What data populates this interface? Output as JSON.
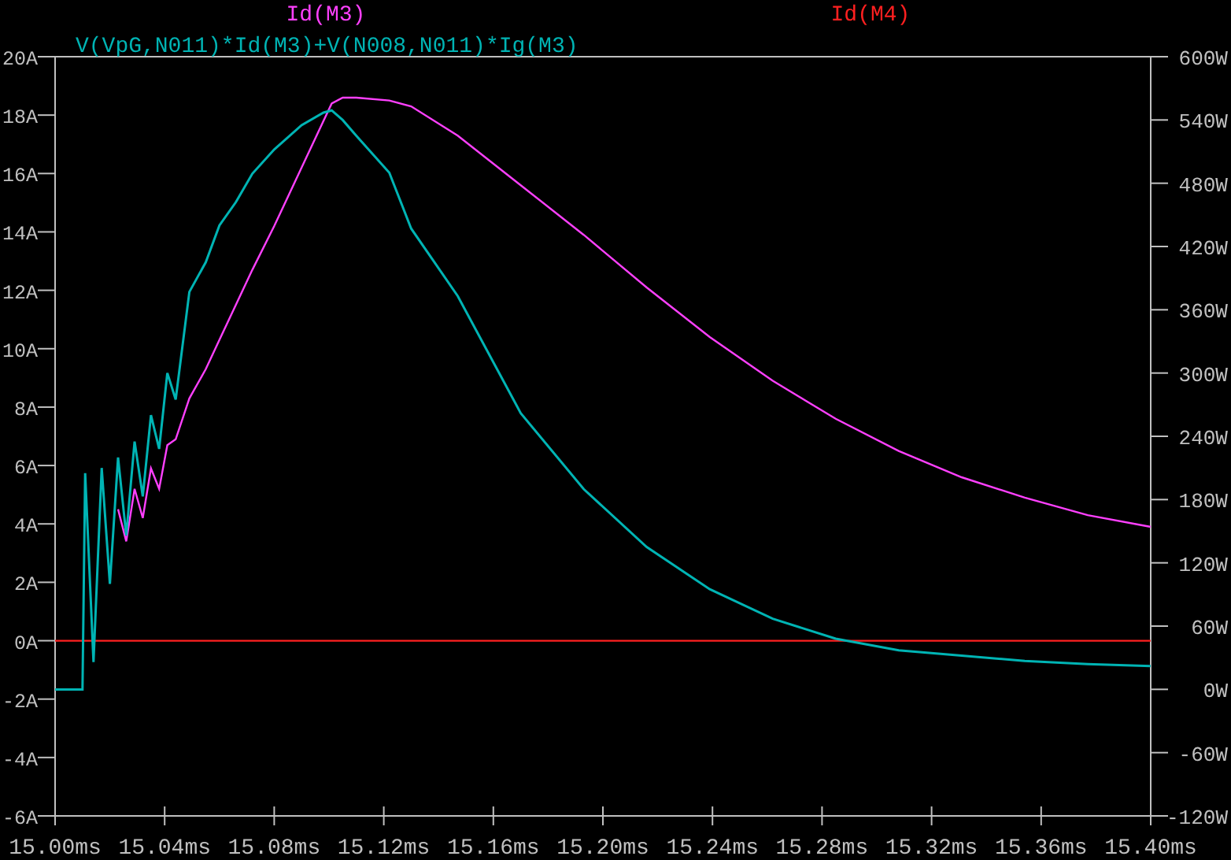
{
  "plot": {
    "chart_data": {
      "type": "line",
      "x": [
        15.0,
        15.01,
        15.011,
        15.014,
        15.017,
        15.02,
        15.023,
        15.026,
        15.029,
        15.032,
        15.035,
        15.038,
        15.041,
        15.044,
        15.049,
        15.055,
        15.06,
        15.066,
        15.072,
        15.08,
        15.09,
        15.098,
        15.101,
        15.105,
        15.11,
        15.122,
        15.13,
        15.147,
        15.17,
        15.193,
        15.216,
        15.239,
        15.262,
        15.285,
        15.308,
        15.331,
        15.354,
        15.377,
        15.4
      ],
      "xlim": [
        15.0,
        15.4
      ],
      "xticks": [
        {
          "value": 15.0,
          "label": "15.00ms"
        },
        {
          "value": 15.04,
          "label": "15.04ms"
        },
        {
          "value": 15.08,
          "label": "15.08ms"
        },
        {
          "value": 15.12,
          "label": "15.12ms"
        },
        {
          "value": 15.16,
          "label": "15.16ms"
        },
        {
          "value": 15.2,
          "label": "15.20ms"
        },
        {
          "value": 15.24,
          "label": "15.24ms"
        },
        {
          "value": 15.28,
          "label": "15.28ms"
        },
        {
          "value": 15.32,
          "label": "15.32ms"
        },
        {
          "value": 15.36,
          "label": "15.36ms"
        },
        {
          "value": 15.4,
          "label": "15.40ms"
        }
      ],
      "ylim": [
        -6,
        20
      ],
      "yticks": [
        {
          "value": 20,
          "label": "20A"
        },
        {
          "value": 18,
          "label": "18A"
        },
        {
          "value": 16,
          "label": "16A"
        },
        {
          "value": 14,
          "label": "14A"
        },
        {
          "value": 12,
          "label": "12A"
        },
        {
          "value": 10,
          "label": "10A"
        },
        {
          "value": 8,
          "label": "8A"
        },
        {
          "value": 6,
          "label": "6A"
        },
        {
          "value": 4,
          "label": "4A"
        },
        {
          "value": 2,
          "label": "2A"
        },
        {
          "value": 0,
          "label": "0A"
        },
        {
          "value": -2,
          "label": "-2A"
        },
        {
          "value": -4,
          "label": "-4A"
        },
        {
          "value": -6,
          "label": "-6A"
        }
      ],
      "y2lim": [
        -120,
        600
      ],
      "y2ticks": [
        {
          "value": 600,
          "label": "600W"
        },
        {
          "value": 540,
          "label": "540W"
        },
        {
          "value": 480,
          "label": "480W"
        },
        {
          "value": 420,
          "label": "420W"
        },
        {
          "value": 360,
          "label": "360W"
        },
        {
          "value": 300,
          "label": "300W"
        },
        {
          "value": 240,
          "label": "240W"
        },
        {
          "value": 180,
          "label": "180W"
        },
        {
          "value": 120,
          "label": "120W"
        },
        {
          "value": 60,
          "label": "60W"
        },
        {
          "value": 0,
          "label": "0W"
        },
        {
          "value": -60,
          "label": "-60W"
        },
        {
          "value": -120,
          "label": "-120W"
        }
      ],
      "series": [
        {
          "name": "Id(M3)",
          "color": "#ff40ff",
          "values": [
            null,
            null,
            null,
            null,
            null,
            null,
            4.5,
            3.4,
            5.2,
            4.2,
            5.9,
            5.2,
            6.7,
            6.9,
            8.3,
            9.3,
            10.3,
            11.5,
            12.7,
            14.2,
            16.2,
            17.8,
            18.4,
            18.6,
            18.6,
            18.5,
            18.3,
            17.3,
            15.6,
            13.9,
            12.1,
            10.4,
            8.9,
            7.6,
            6.5,
            5.6,
            4.9,
            4.3,
            3.9
          ]
        },
        {
          "name": "Id(M4)",
          "color": "#ff2020",
          "values": [
            0,
            0,
            0,
            0,
            0,
            0,
            0,
            0,
            0,
            0,
            0,
            0,
            0,
            0,
            0,
            0,
            0,
            0,
            0,
            0,
            0,
            0,
            0,
            0,
            0,
            0,
            0,
            0,
            0,
            0,
            0,
            0,
            0,
            0,
            0,
            0,
            0,
            0,
            0
          ]
        },
        {
          "name": "V(VpG,N011)*Id(M3)+V(N008,N011)*Ig(M3)",
          "color": "#00b4b4",
          "axis": "y2",
          "values": [
            0,
            0,
            205,
            26,
            210,
            100,
            220,
            146,
            235,
            183,
            260,
            228,
            300,
            275,
            377,
            405,
            440,
            462,
            489,
            512,
            535,
            547,
            549,
            540,
            525,
            490,
            437,
            373,
            262,
            190,
            135,
            95,
            67,
            48,
            37,
            32,
            27,
            24,
            22
          ]
        }
      ]
    }
  }
}
